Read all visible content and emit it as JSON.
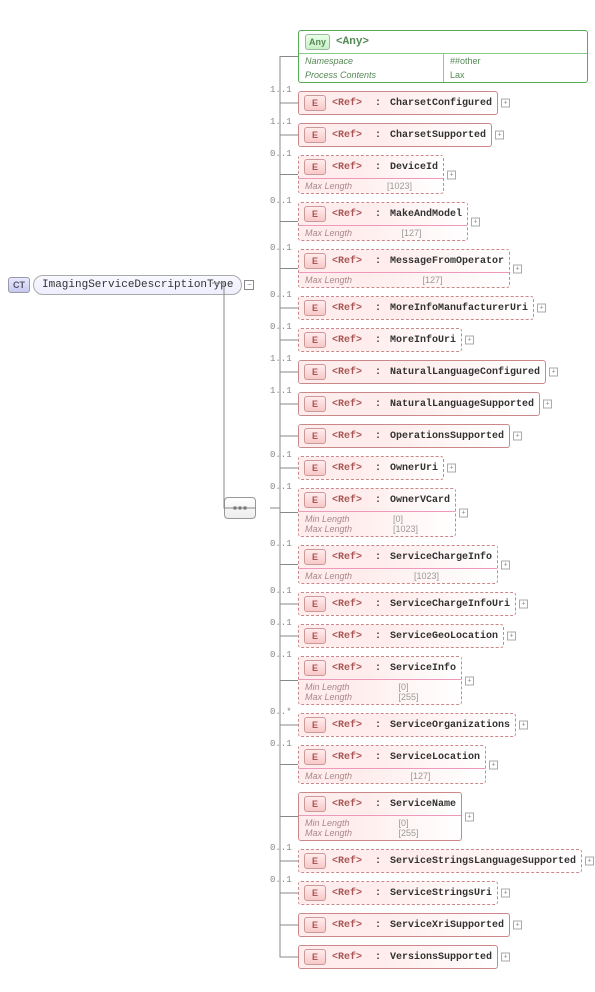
{
  "root": {
    "badge": "CT",
    "name": "ImagingServiceDescriptionType"
  },
  "any": {
    "badge": "Any",
    "title": "<Any>",
    "rows": {
      "ns_label": "Namespace",
      "ns_value": "##other",
      "pc_label": "Process Contents",
      "pc_value": "Lax"
    }
  },
  "children": [
    {
      "occurs": "1..1",
      "name": "CharsetConfigured",
      "dashed": false,
      "facets": null,
      "plus": true
    },
    {
      "occurs": "1..1",
      "name": "CharsetSupported",
      "dashed": false,
      "facets": null,
      "plus": true
    },
    {
      "occurs": "0..1",
      "name": "DeviceId",
      "dashed": true,
      "facets": [
        [
          "Max Length",
          "[1023]"
        ]
      ],
      "plus": true
    },
    {
      "occurs": "0..1",
      "name": "MakeAndModel",
      "dashed": true,
      "facets": [
        [
          "Max Length",
          "[127]"
        ]
      ],
      "plus": true
    },
    {
      "occurs": "0..1",
      "name": "MessageFromOperator",
      "dashed": true,
      "facets": [
        [
          "Max Length",
          "[127]"
        ]
      ],
      "plus": true
    },
    {
      "occurs": "0..1",
      "name": "MoreInfoManufacturerUri",
      "dashed": true,
      "facets": null,
      "plus": true
    },
    {
      "occurs": "0..1",
      "name": "MoreInfoUri",
      "dashed": true,
      "facets": null,
      "plus": true
    },
    {
      "occurs": "1..1",
      "name": "NaturalLanguageConfigured",
      "dashed": false,
      "facets": null,
      "plus": true
    },
    {
      "occurs": "1..1",
      "name": "NaturalLanguageSupported",
      "dashed": false,
      "facets": null,
      "plus": true
    },
    {
      "occurs": "",
      "name": "OperationsSupported",
      "dashed": false,
      "facets": null,
      "plus": true
    },
    {
      "occurs": "0..1",
      "name": "OwnerUri",
      "dashed": true,
      "facets": null,
      "plus": true
    },
    {
      "occurs": "0..1",
      "name": "OwnerVCard",
      "dashed": true,
      "facets": [
        [
          "Min Length",
          "[0]"
        ],
        [
          "Max Length",
          "[1023]"
        ]
      ],
      "plus": true
    },
    {
      "occurs": "0..1",
      "name": "ServiceChargeInfo",
      "dashed": true,
      "facets": [
        [
          "Max Length",
          "[1023]"
        ]
      ],
      "plus": true
    },
    {
      "occurs": "0..1",
      "name": "ServiceChargeInfoUri",
      "dashed": true,
      "facets": null,
      "plus": true
    },
    {
      "occurs": "0..1",
      "name": "ServiceGeoLocation",
      "dashed": true,
      "facets": null,
      "plus": true
    },
    {
      "occurs": "0..1",
      "name": "ServiceInfo",
      "dashed": true,
      "facets": [
        [
          "Min Length",
          "[0]"
        ],
        [
          "Max Length",
          "[255]"
        ]
      ],
      "plus": true
    },
    {
      "occurs": "0..*",
      "name": "ServiceOrganizations",
      "dashed": true,
      "facets": null,
      "plus": true
    },
    {
      "occurs": "0..1",
      "name": "ServiceLocation",
      "dashed": true,
      "facets": [
        [
          "Max Length",
          "[127]"
        ]
      ],
      "plus": true
    },
    {
      "occurs": "",
      "name": "ServiceName",
      "dashed": false,
      "facets": [
        [
          "Min Length",
          "[0]"
        ],
        [
          "Max Length",
          "[255]"
        ]
      ],
      "plus": true
    },
    {
      "occurs": "0..1",
      "name": "ServiceStringsLanguageSupported",
      "dashed": true,
      "facets": null,
      "plus": true
    },
    {
      "occurs": "0..1",
      "name": "ServiceStringsUri",
      "dashed": true,
      "facets": null,
      "plus": true
    },
    {
      "occurs": "",
      "name": "ServiceXriSupported",
      "dashed": false,
      "facets": null,
      "plus": true
    },
    {
      "occurs": "",
      "name": "VersionsSupported",
      "dashed": false,
      "facets": null,
      "plus": true
    }
  ],
  "labels": {
    "ref": "<Ref>",
    "sep": ":"
  }
}
